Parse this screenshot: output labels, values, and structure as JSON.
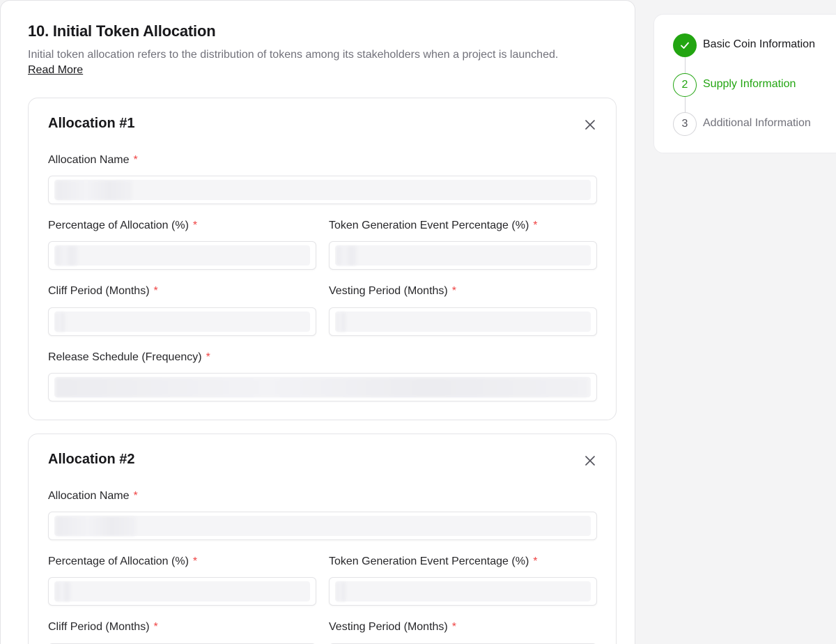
{
  "section": {
    "title": "10. Initial Token Allocation",
    "description": "Initial token allocation refers to the distribution of tokens among its stakeholders when a project is launched.",
    "read_more": "Read More"
  },
  "allocations": [
    {
      "title": "Allocation #1",
      "name_label": "Allocation Name",
      "percentage_label": "Percentage of Allocation (%)",
      "tge_label": "Token Generation Event Percentage (%)",
      "cliff_label": "Cliff Period (Months)",
      "vesting_label": "Vesting Period (Months)",
      "release_label": "Release Schedule (Frequency)"
    },
    {
      "title": "Allocation #2",
      "name_label": "Allocation Name",
      "percentage_label": "Percentage of Allocation (%)",
      "tge_label": "Token Generation Event Percentage (%)",
      "cliff_label": "Cliff Period (Months)",
      "vesting_label": "Vesting Period (Months)"
    }
  ],
  "required_marker": "*",
  "stepper": {
    "steps": [
      {
        "number": "1",
        "label": "Basic Coin Information",
        "state": "completed"
      },
      {
        "number": "2",
        "label": "Supply Information",
        "state": "active"
      },
      {
        "number": "3",
        "label": "Additional Information",
        "state": "upcoming"
      }
    ]
  },
  "colors": {
    "accent": "#22a511",
    "required": "#ef4444",
    "muted_text": "#71717a",
    "border": "#e4e4e7"
  }
}
